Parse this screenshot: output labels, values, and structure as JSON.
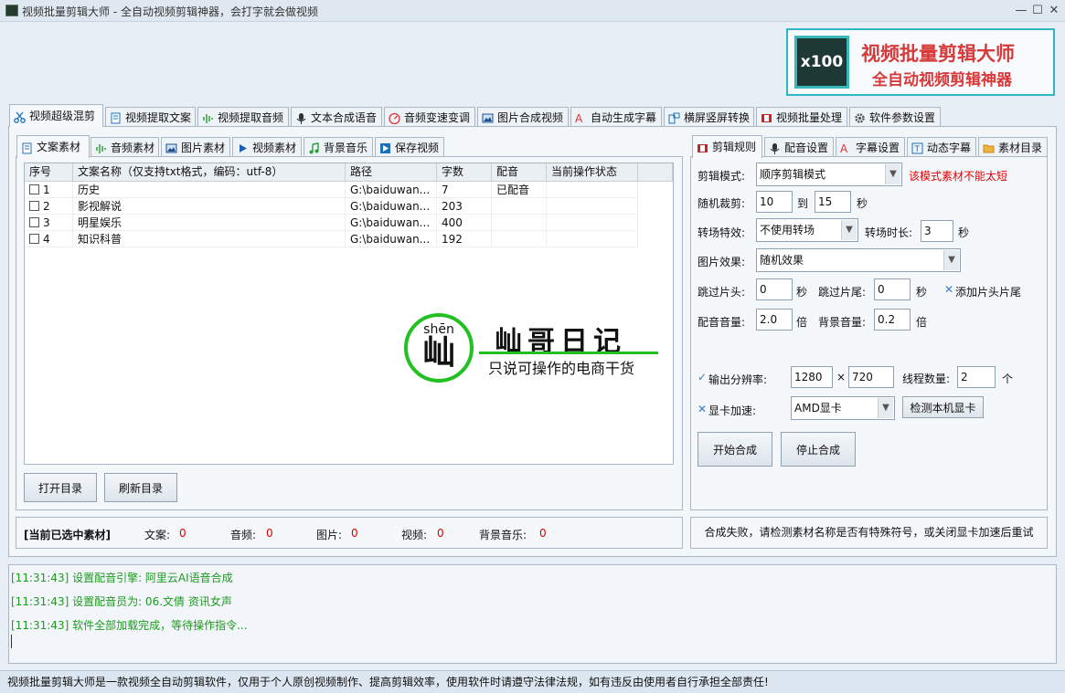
{
  "window": {
    "title": "视频批量剪辑大师 - 全自动视频剪辑神器，会打字就会做视频",
    "min": "—",
    "max": "☐",
    "close": "✕"
  },
  "brand": {
    "logo": "x100",
    "line1": "视频批量剪辑大师",
    "line2": "全自动视频剪辑神器"
  },
  "main_tabs": [
    "视频超级混剪",
    "视频提取文案",
    "视频提取音频",
    "文本合成语音",
    "音频变速变调",
    "图片合成视频",
    "自动生成字幕",
    "横屏竖屏转换",
    "视频批量处理",
    "软件参数设置"
  ],
  "sub_tabs": [
    "文案素材",
    "音频素材",
    "图片素材",
    "视频素材",
    "背景音乐",
    "保存视频"
  ],
  "table": {
    "headers": [
      "序号",
      "文案名称（仅支持txt格式，编码：utf-8）",
      "路径",
      "字数",
      "配音",
      "当前操作状态"
    ],
    "rows": [
      {
        "no": "1",
        "name": "历史",
        "path": "G:\\baiduwan...",
        "count": "7",
        "dub": "已配音",
        "status": ""
      },
      {
        "no": "2",
        "name": "影视解说",
        "path": "G:\\baiduwan...",
        "count": "203",
        "dub": "",
        "status": ""
      },
      {
        "no": "3",
        "name": "明星娱乐",
        "path": "G:\\baiduwan...",
        "count": "400",
        "dub": "",
        "status": ""
      },
      {
        "no": "4",
        "name": "知识科普",
        "path": "G:\\baiduwan...",
        "count": "192",
        "dub": "",
        "status": ""
      }
    ]
  },
  "watermark": {
    "pinyin": "shēn",
    "char": "屾",
    "title": "屾哥日记",
    "subtitle": "只说可操作的电商干货"
  },
  "buttons": {
    "open_dir": "打开目录",
    "refresh_dir": "刷新目录",
    "start": "开始合成",
    "stop": "停止合成",
    "detect_gpu": "检测本机显卡"
  },
  "selected": {
    "title": "[当前已选中素材]",
    "text_label": "文案:",
    "text_val": "0",
    "audio_label": "音频:",
    "audio_val": "0",
    "image_label": "图片:",
    "image_val": "0",
    "video_label": "视频:",
    "video_val": "0",
    "bgm_label": "背景音乐:",
    "bgm_val": "0"
  },
  "right_tabs": [
    "剪辑规则",
    "配音设置",
    "字幕设置",
    "动态字幕",
    "素材目录"
  ],
  "settings": {
    "mode_label": "剪辑模式:",
    "mode_value": "顺序剪辑模式",
    "mode_warn": "该模式素材不能太短",
    "crop_label": "随机裁剪:",
    "crop_from": "10",
    "crop_to_label": "到",
    "crop_to": "15",
    "crop_unit": "秒",
    "transition_label": "转场特效:",
    "transition_value": "不使用转场",
    "trans_dur_label": "转场时长:",
    "trans_dur": "3",
    "trans_unit": "秒",
    "image_fx_label": "图片效果:",
    "image_fx_value": "随机效果",
    "skip_head_label": "跳过片头:",
    "skip_head": "0",
    "skip_head_unit": "秒",
    "skip_tail_label": "跳过片尾:",
    "skip_tail": "0",
    "skip_tail_unit": "秒",
    "add_headtail": "添加片头片尾",
    "dub_vol_label": "配音音量:",
    "dub_vol": "2.0",
    "dub_vol_unit": "倍",
    "bg_vol_label": "背景音量:",
    "bg_vol": "0.2",
    "bg_vol_unit": "倍",
    "res_label": "输出分辨率:",
    "res_w": "1280",
    "res_x": "×",
    "res_h": "720",
    "threads_label": "线程数量:",
    "threads": "2",
    "threads_unit": "个",
    "gpu_label": "显卡加速:",
    "gpu_value": "AMD显卡"
  },
  "message": "合成失败，请检测素材名称是否有特殊符号，或关闭显卡加速后重试",
  "log": [
    "[11:31:43] 设置配音引擎:  阿里云AI语音合成",
    "[11:31:43] 设置配音员为: 06.文倩 资讯女声",
    "[11:31:43] 软件全部加载完成，等待操作指令..."
  ],
  "statusbar": "视频批量剪辑大师是一款视频全自动剪辑软件，仅用于个人原创视频制作、提高剪辑效率，使用软件时请遵守法律法规，如有违反由使用者自行承担全部责任!",
  "colors": {
    "accent": "#2bb8c6",
    "brand_red": "#d63a3a",
    "log_green": "#1f9a1f",
    "warn_red": "#e00000"
  }
}
